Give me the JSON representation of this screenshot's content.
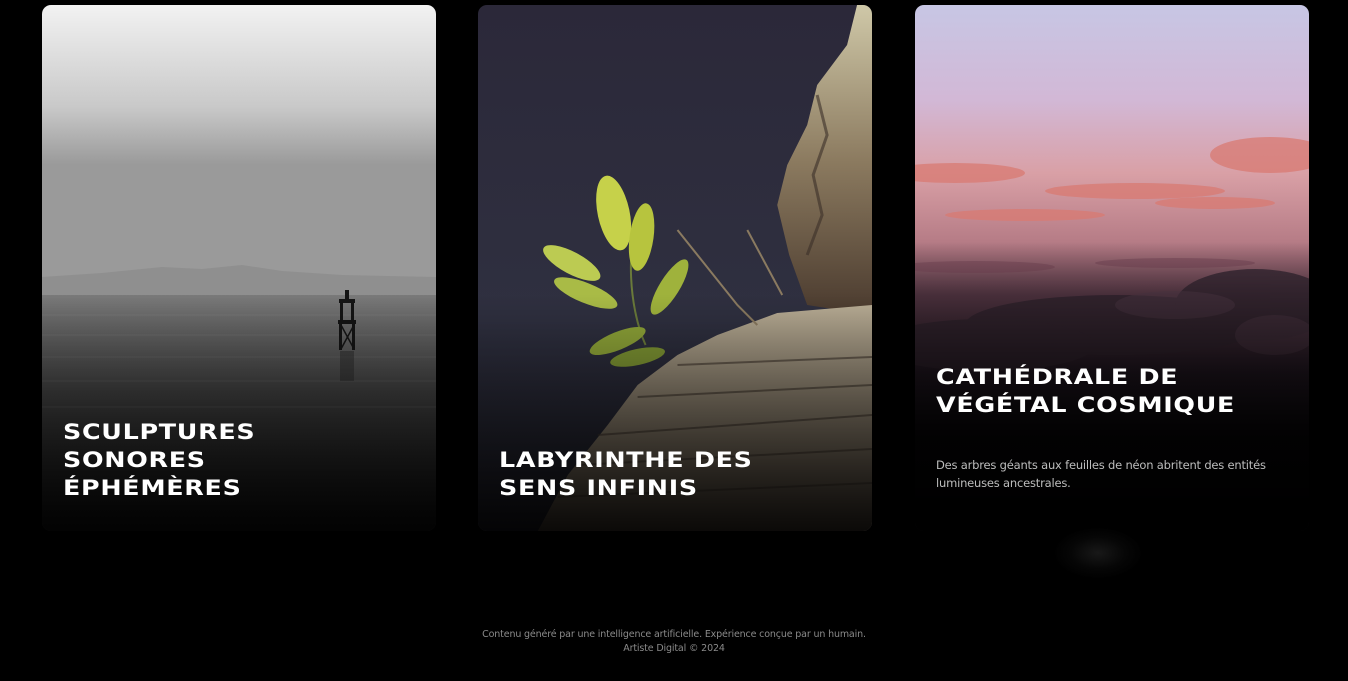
{
  "cards": [
    {
      "title": "SCULPTURES SONORES ÉPHÉMÈRES",
      "description": "",
      "image": "misty-lake-with-buoy-image"
    },
    {
      "title": "LABYRINTHE DES SENS INFINIS",
      "description": "",
      "image": "plant-on-rock-cliff-image"
    },
    {
      "title": "CATHÉDRALE DE VÉGÉTAL COSMIQUE",
      "description": "Des arbres géants aux feuilles de néon abritent des entités lumineuses ancestrales.",
      "image": "sunset-above-clouds-image"
    }
  ],
  "footer": {
    "line1": "Contenu généré par une intelligence artificielle. Expérience conçue par un humain.",
    "line2": "Artiste Digital © 2024"
  },
  "colors": {
    "background": "#000000",
    "title_text": "#ffffff",
    "description_text": "#bdbdbd",
    "footer_text": "#8a8a8a"
  }
}
